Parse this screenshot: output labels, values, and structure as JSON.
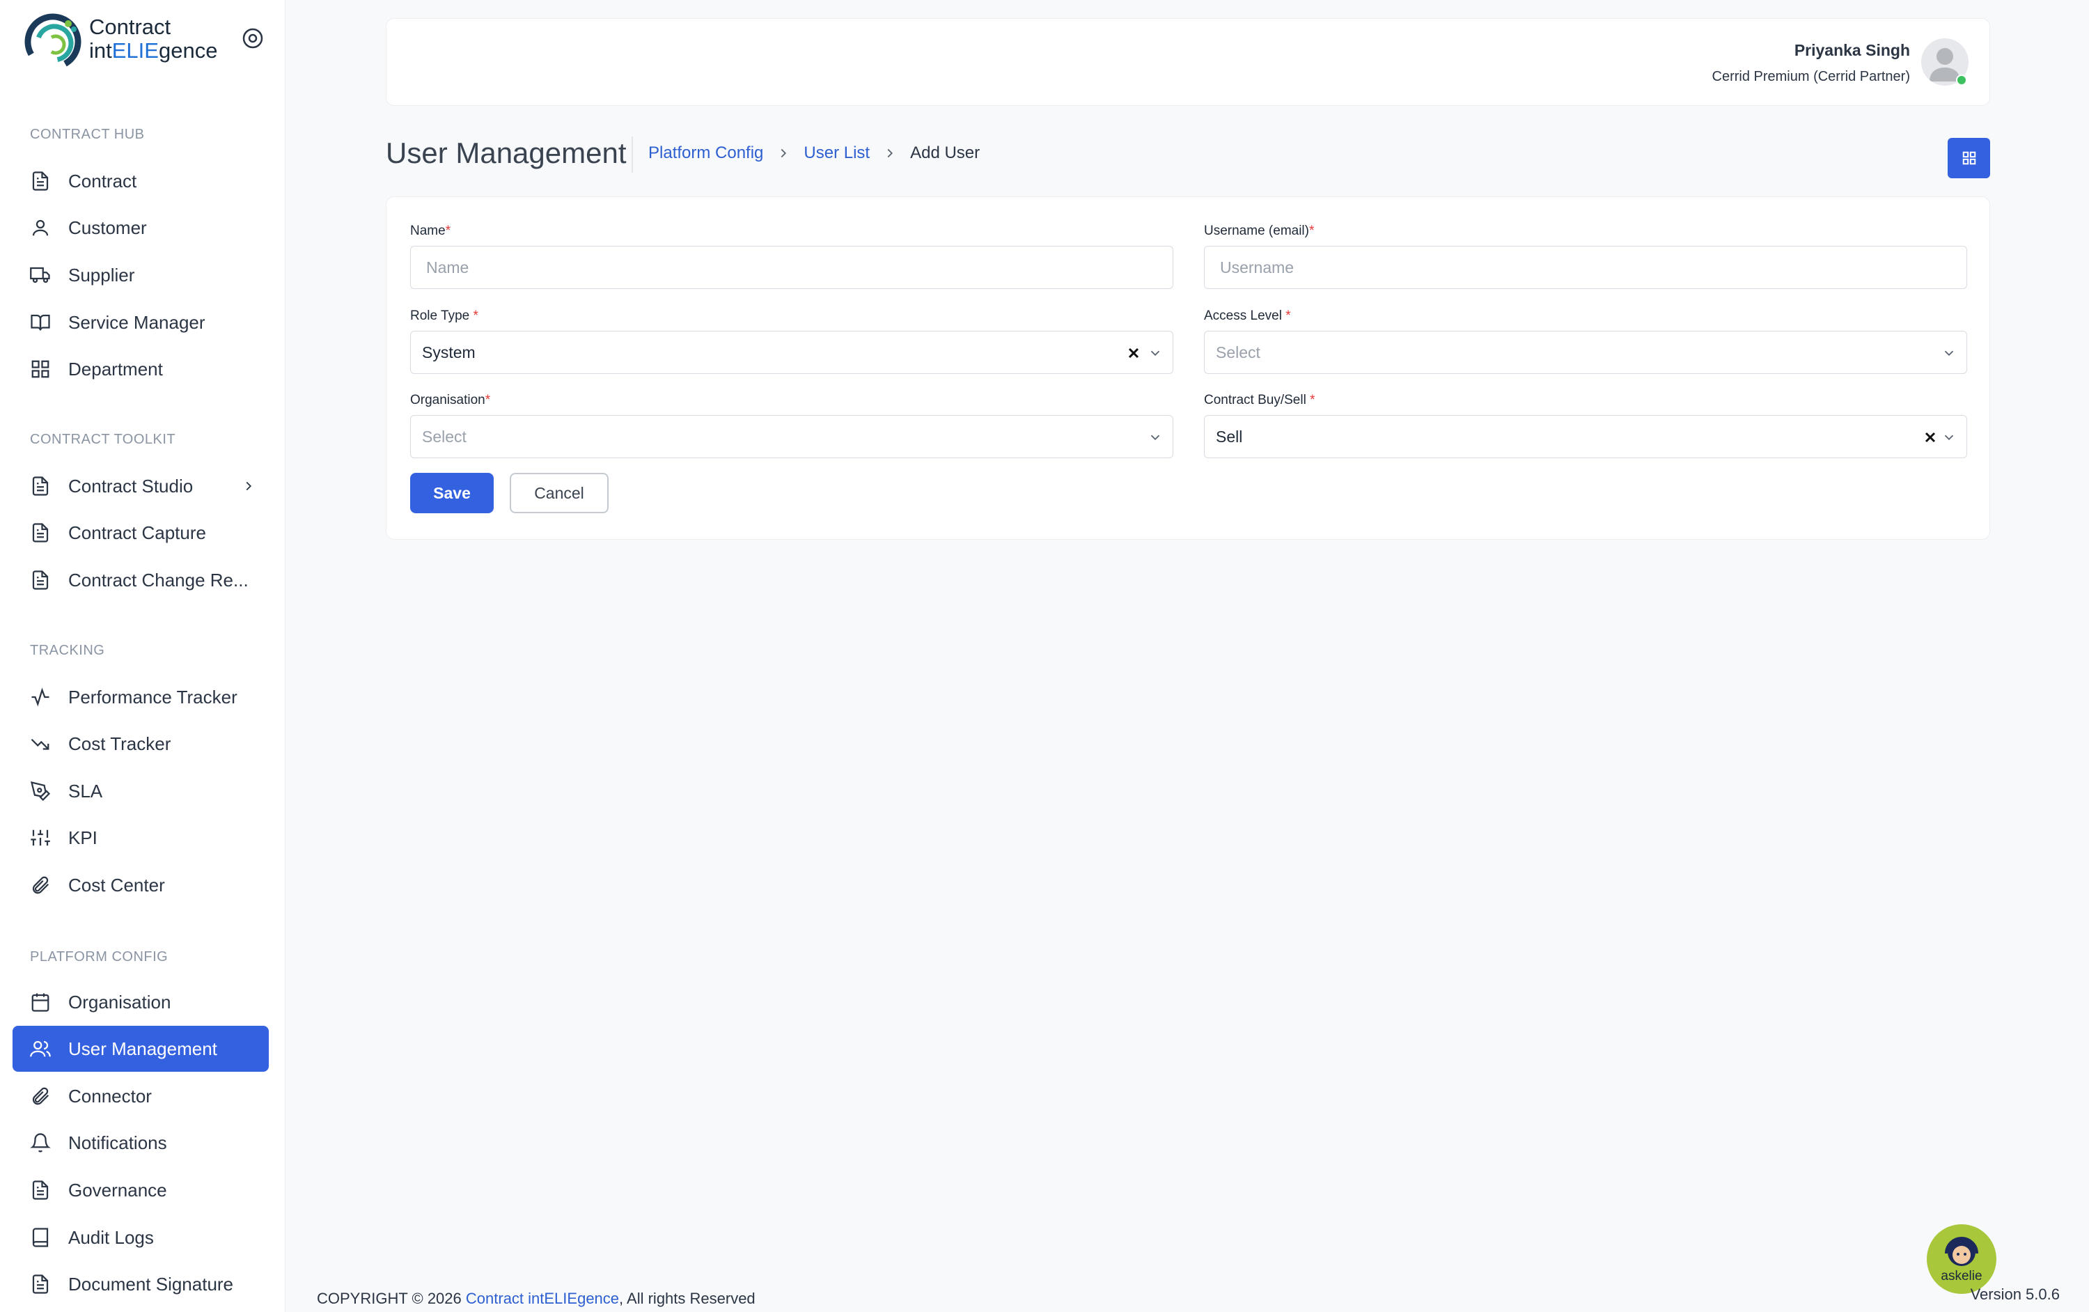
{
  "brand": {
    "line1": "Contract",
    "line2_pre": "int",
    "line2_hl": "ELIE",
    "line2_post": "gence"
  },
  "sidebar": {
    "sections": [
      {
        "title": "CONTRACT HUB"
      },
      {
        "title": "CONTRACT TOOLKIT"
      },
      {
        "title": "TRACKING"
      },
      {
        "title": "PLATFORM CONFIG"
      }
    ],
    "items": [
      {
        "label": "Contract",
        "icon": "document-icon"
      },
      {
        "label": "Customer",
        "icon": "person-icon"
      },
      {
        "label": "Supplier",
        "icon": "truck-icon"
      },
      {
        "label": "Service Manager",
        "icon": "book-open-icon"
      },
      {
        "label": "Department",
        "icon": "grid-icon"
      },
      {
        "label": "Contract Studio",
        "icon": "document-icon"
      },
      {
        "label": "Contract Capture",
        "icon": "document-icon"
      },
      {
        "label": "Contract Change Re...",
        "icon": "document-icon"
      },
      {
        "label": "Performance Tracker",
        "icon": "activity-icon"
      },
      {
        "label": "Cost Tracker",
        "icon": "trend-down-icon"
      },
      {
        "label": "SLA",
        "icon": "pen-tool-icon"
      },
      {
        "label": "KPI",
        "icon": "sliders-icon"
      },
      {
        "label": "Cost Center",
        "icon": "paperclip-icon"
      },
      {
        "label": "Organisation",
        "icon": "calendar-icon"
      },
      {
        "label": "User Management",
        "icon": "users-icon"
      },
      {
        "label": "Connector",
        "icon": "paperclip-icon"
      },
      {
        "label": "Notifications",
        "icon": "bell-icon"
      },
      {
        "label": "Governance",
        "icon": "document-icon"
      },
      {
        "label": "Audit Logs",
        "icon": "book-icon"
      },
      {
        "label": "Document Signature",
        "icon": "document-icon"
      }
    ]
  },
  "header": {
    "user_name": "Priyanka Singh",
    "user_role": "Cerrid Premium (Cerrid Partner)"
  },
  "page": {
    "title": "User Management",
    "breadcrumb": [
      "Platform Config",
      "User List",
      "Add User"
    ]
  },
  "form": {
    "name_label": "Name",
    "name_placeholder": "Name",
    "username_label": "Username (email)",
    "username_placeholder": "Username",
    "role_label": "Role Type ",
    "role_value": "System",
    "access_label": "Access Level ",
    "access_placeholder": "Select",
    "org_label": "Organisation",
    "org_placeholder": "Select",
    "buysell_label": "Contract Buy/Sell ",
    "buysell_value": "Sell",
    "required_mark": "*",
    "save_label": "Save",
    "cancel_label": "Cancel"
  },
  "footer": {
    "copyright_pre": "COPYRIGHT © 2026 ",
    "brand": "Contract intELIEgence",
    "copyright_post": ", All rights Reserved",
    "version": "Version 5.0.6",
    "assistant": "askelie"
  },
  "colors": {
    "primary": "#3461e0",
    "link": "#2d5fd1",
    "required": "#e53935",
    "online": "#3cc15e",
    "assistant_bg": "#a8c73a"
  }
}
